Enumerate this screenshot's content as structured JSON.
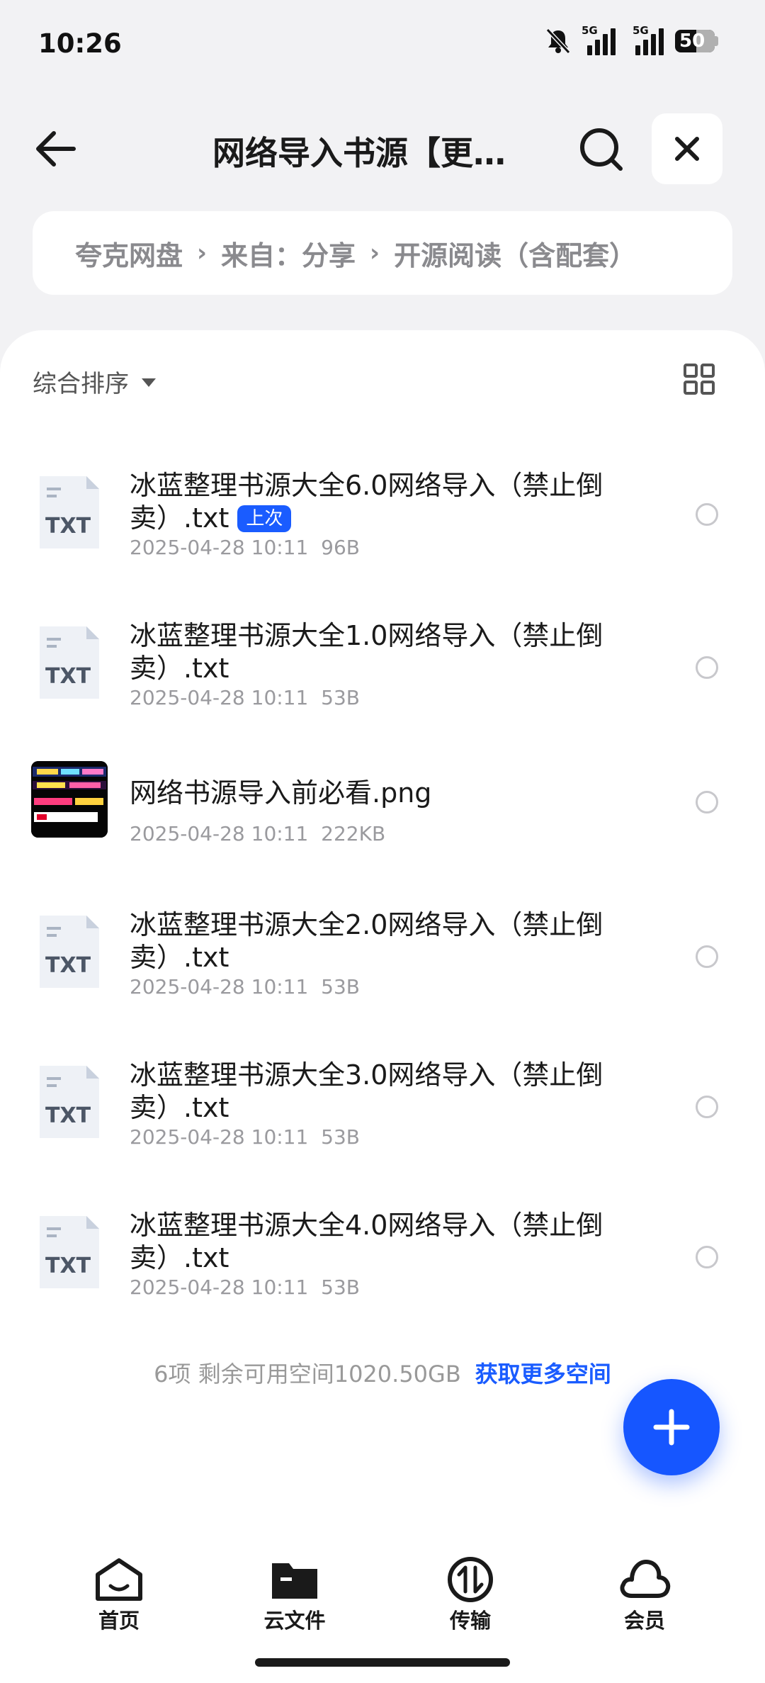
{
  "status_bar": {
    "time": "10:26",
    "network_1": "5G",
    "network_2": "5G",
    "battery": "50"
  },
  "header": {
    "title": "网络导入书源【更新】"
  },
  "breadcrumb": {
    "items": [
      "夸克网盘",
      "来自：分享",
      "开源阅读（含配套）"
    ]
  },
  "toolbar": {
    "sort_label": "综合排序"
  },
  "files": [
    {
      "name": "冰蓝整理书源大全6.0网络导入（禁止倒卖）.txt",
      "badge": "上次",
      "date": "2025-04-28 10:11",
      "size": "96B",
      "type": "TXT"
    },
    {
      "name": "冰蓝整理书源大全1.0网络导入（禁止倒卖）.txt",
      "date": "2025-04-28 10:11",
      "size": "53B",
      "type": "TXT"
    },
    {
      "name": "网络书源导入前必看.png",
      "date": "2025-04-28 10:11",
      "size": "222KB",
      "type": "PNG"
    },
    {
      "name": "冰蓝整理书源大全2.0网络导入（禁止倒卖）.txt",
      "date": "2025-04-28 10:11",
      "size": "53B",
      "type": "TXT"
    },
    {
      "name": "冰蓝整理书源大全3.0网络导入（禁止倒卖）.txt",
      "date": "2025-04-28 10:11",
      "size": "53B",
      "type": "TXT"
    },
    {
      "name": "冰蓝整理书源大全4.0网络导入（禁止倒卖）.txt",
      "date": "2025-04-28 10:11",
      "size": "53B",
      "type": "TXT"
    }
  ],
  "footer": {
    "summary": "6项 剩余可用空间1020.50GB",
    "link": "获取更多空间"
  },
  "bottom_nav": {
    "items": [
      "首页",
      "云文件",
      "传输",
      "会员"
    ]
  },
  "colors": {
    "accent": "#1a5cff",
    "background": "#f2f2f4"
  }
}
